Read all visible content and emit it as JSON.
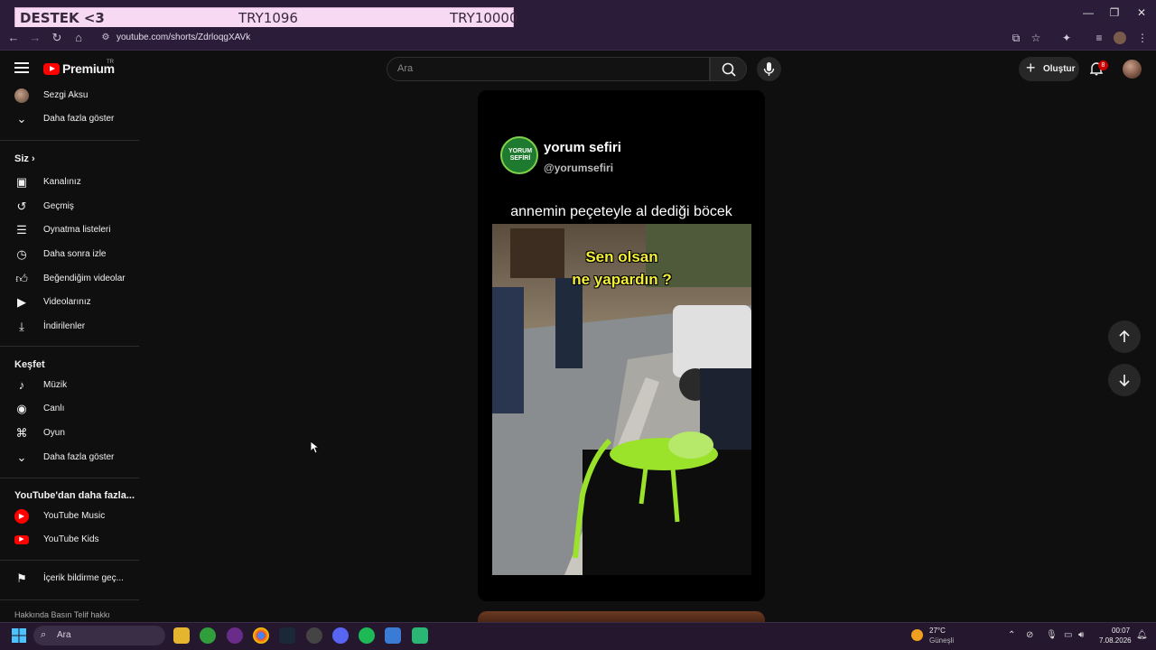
{
  "overlay": {
    "label": "DESTEK <3",
    "amount_current": "TRY1096",
    "amount_goal": "TRY10000"
  },
  "browser": {
    "url": "youtube.com/shorts/ZdrloqgXAVk"
  },
  "header": {
    "logo_text": "Premium",
    "logo_region": "TR",
    "search_placeholder": "Ara",
    "create_label": "Oluştur",
    "notification_count": "8"
  },
  "sidebar": {
    "top": [
      {
        "label": "Sezgi Aksu",
        "icon": "channel-avatar"
      },
      {
        "label": "Daha fazla göster",
        "icon": "chevron-down-icon"
      }
    ],
    "you_heading": "Siz",
    "you_items": [
      {
        "label": "Kanalınız",
        "icon": "account-box-icon"
      },
      {
        "label": "Geçmiş",
        "icon": "history-icon"
      },
      {
        "label": "Oynatma listeleri",
        "icon": "playlist-icon"
      },
      {
        "label": "Daha sonra izle",
        "icon": "clock-icon"
      },
      {
        "label": "Beğendiğim videolar",
        "icon": "thumbs-up-icon"
      },
      {
        "label": "Videolarınız",
        "icon": "video-icon"
      },
      {
        "label": "İndirilenler",
        "icon": "download-icon"
      }
    ],
    "explore_heading": "Keşfet",
    "explore_items": [
      {
        "label": "Müzik",
        "icon": "music-note-icon"
      },
      {
        "label": "Canlı",
        "icon": "live-icon"
      },
      {
        "label": "Oyun",
        "icon": "gamepad-icon"
      },
      {
        "label": "Daha fazla göster",
        "icon": "chevron-down-icon"
      }
    ],
    "more_heading": "YouTube'dan daha fazla...",
    "more_items": [
      {
        "label": "YouTube Music",
        "icon": "youtube-music-icon"
      },
      {
        "label": "YouTube Kids",
        "icon": "youtube-kids-icon"
      }
    ],
    "report_label": "İçerik bildirme geç...",
    "footer": "Hakkında  Basın  Telif hakkı"
  },
  "short": {
    "channel_logo_text": "YORUM SEFİRİ",
    "channel_name": "yorum sefiri",
    "channel_handle": "@yorumsefiri",
    "caption": "annemin peçeteyle al dediği böcek",
    "overlay_line1": "Sen olsan",
    "overlay_line2": "ne yapardın ?"
  },
  "taskbar": {
    "search_label": "Ara",
    "weather_temp": "27°C",
    "weather_desc": "Güneşli",
    "time": "00:07",
    "date": "7.08.2026"
  }
}
